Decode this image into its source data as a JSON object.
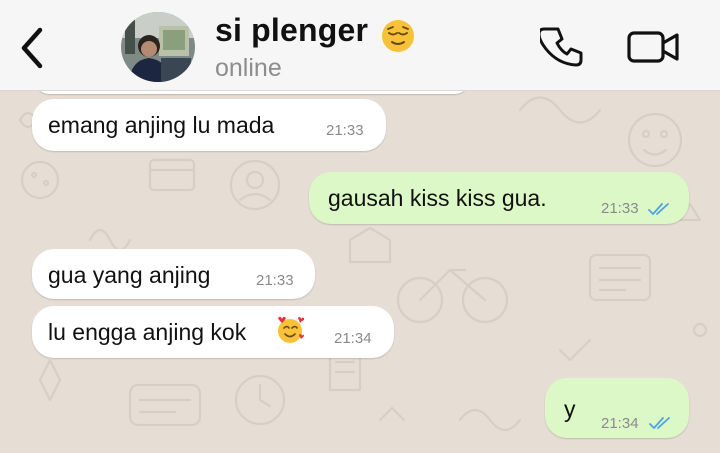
{
  "header": {
    "back_icon": "chevron-left-icon",
    "contact_name": "si plenger",
    "name_emoji": "😌",
    "status": "online",
    "call_icon": "phone-icon",
    "video_icon": "video-camera-icon"
  },
  "messages": [
    {
      "direction": "in",
      "text": "emang anjing lu mada",
      "time": "21:33"
    },
    {
      "direction": "out",
      "text": "gausah kiss kiss gua.",
      "time": "21:33",
      "status": "read"
    },
    {
      "direction": "in",
      "text": "gua yang anjing",
      "time": "21:33"
    },
    {
      "direction": "in",
      "text": "lu engga anjing kok",
      "emoji": "🥰",
      "time": "21:34"
    },
    {
      "direction": "out",
      "text": "y",
      "time": "21:34",
      "status": "read"
    }
  ],
  "colors": {
    "header_bg": "#f6f6f6",
    "wallpaper": "#e6ddd4",
    "incoming_bubble": "#ffffff",
    "outgoing_bubble": "#dcf8c6",
    "read_ticks": "#4fa3e0",
    "muted_text": "#8d8d8d"
  }
}
